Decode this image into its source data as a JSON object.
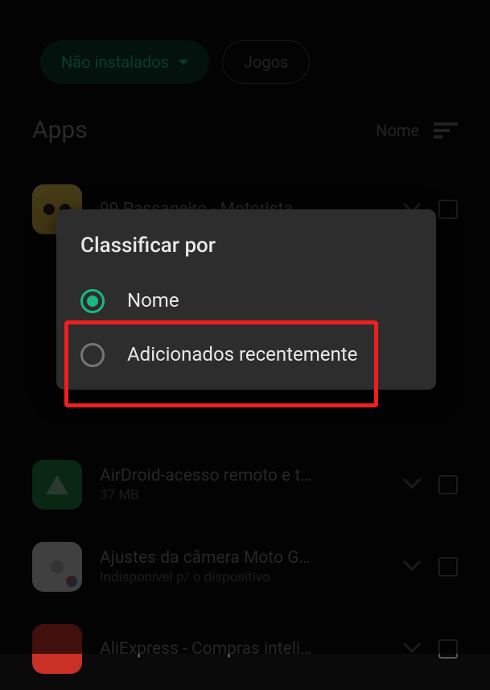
{
  "filters": {
    "installed_chip": "Não instalados",
    "games_chip": "Jogos"
  },
  "section": {
    "title": "Apps",
    "sort_label": "Nome"
  },
  "apps": [
    {
      "name": "99 Passageiro - Motorista…",
      "sub": ""
    },
    {
      "name": "AirDroid-acesso remoto e t…",
      "sub": "37 MB"
    },
    {
      "name": "Ajustes da câmera Moto G…",
      "sub": "Indisponível p/ o dispositivo"
    },
    {
      "name": "AliExpress - Compras inteli…",
      "sub": ""
    }
  ],
  "dialog": {
    "title": "Classificar por",
    "options": [
      {
        "label": "Nome",
        "selected": true
      },
      {
        "label": "Adicionados recentemente",
        "selected": false
      }
    ]
  }
}
